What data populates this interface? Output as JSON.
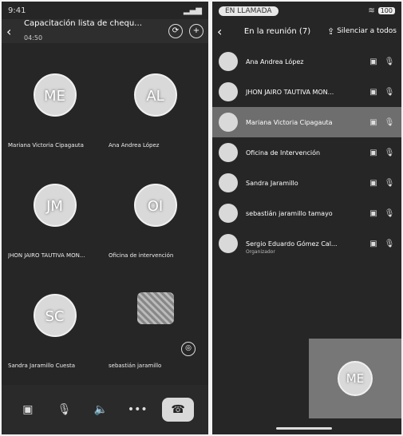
{
  "left": {
    "status": {
      "time": "9:41"
    },
    "header": {
      "title": "Capacitación lista de chequeo",
      "subtitle": "04:50"
    },
    "tiles": [
      {
        "initials": "ME",
        "name": "Mariana Victoria Cipagauta"
      },
      {
        "initials": "AL",
        "name": "Ana Andrea López"
      },
      {
        "initials": "JM",
        "name": "JHON JAIRO TAUTIVA MON..."
      },
      {
        "initials": "OI",
        "name": "Oficina de intervención"
      },
      {
        "initials": "SC",
        "name": "Sandra Jaramillo Cuesta"
      },
      {
        "initials": "",
        "name": "sebastián jaramillo"
      }
    ]
  },
  "right": {
    "status": {
      "badge": "EN LLAMADA",
      "battery": "100"
    },
    "header": {
      "title": "En la reunión (7)",
      "mute_all": "Silenciar a todos"
    },
    "participants": [
      {
        "name": "Ana Andrea López"
      },
      {
        "name": "JHON JAIRO TAUTIVA MON..."
      },
      {
        "name": "Mariana Victoria Cipagauta"
      },
      {
        "name": "Oficina de Intervención"
      },
      {
        "name": "Sandra Jaramillo"
      },
      {
        "name": "sebastián jaramillo tamayo"
      },
      {
        "name": "Sergio Eduardo Gómez Cal...",
        "note": "Organizador"
      }
    ],
    "selfview": {
      "initials": "ME"
    }
  }
}
